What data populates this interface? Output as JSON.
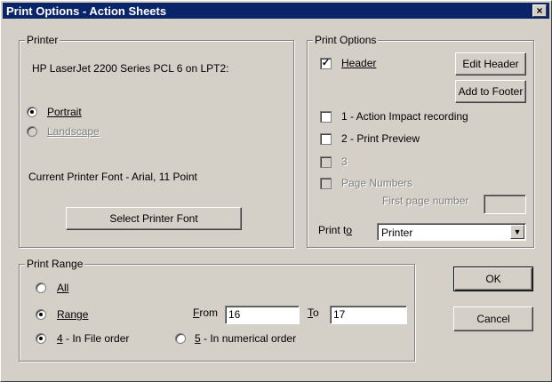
{
  "window": {
    "title": "Print Options - Action Sheets",
    "close": "×"
  },
  "printer": {
    "legend": "Printer",
    "name": "HP LaserJet 2200 Series PCL 6 on LPT2:",
    "portrait": "Portrait",
    "landscape": "Landscape",
    "font_info": "Current Printer Font - Arial, 11 Point",
    "select_font_btn": "Select Printer Font"
  },
  "print_options": {
    "legend": "Print Options",
    "header": "Header",
    "edit_header_btn": "Edit Header",
    "add_footer_btn": "Add to Footer",
    "opt1": "1 - Action Impact recording",
    "opt2": "2 - Print Preview",
    "opt3": "3",
    "page_numbers": "Page Numbers",
    "first_page_label": "First page number",
    "first_page_value": "",
    "print_to_label": "Print to",
    "print_to_value": "Printer"
  },
  "print_range": {
    "legend": "Print Range",
    "all": "All",
    "range": "Range",
    "from_label": "From",
    "from_value": "16",
    "to_label": "To",
    "to_value": "17",
    "file_order": "4 - In File order",
    "numerical_order": "5 - In numerical order"
  },
  "buttons": {
    "ok": "OK",
    "cancel": "Cancel"
  }
}
